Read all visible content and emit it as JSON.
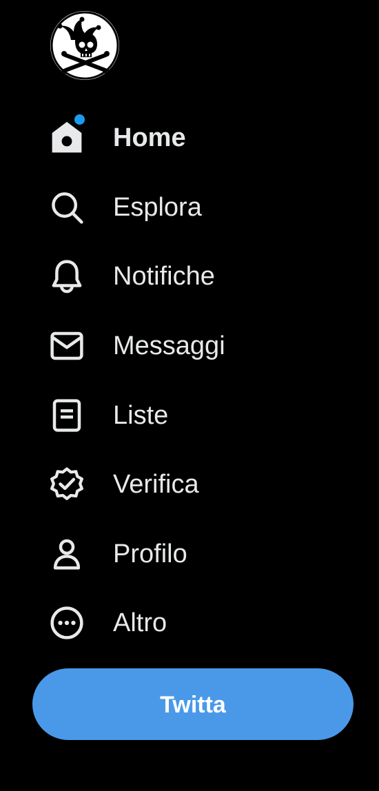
{
  "logo": {
    "icon": "jolly-roger-jester-skull-icon"
  },
  "nav": {
    "items": [
      {
        "label": "Home",
        "icon": "home-icon",
        "active": true
      },
      {
        "label": "Esplora",
        "icon": "search-icon",
        "active": false
      },
      {
        "label": "Notifiche",
        "icon": "bell-icon",
        "active": false
      },
      {
        "label": "Messaggi",
        "icon": "envelope-icon",
        "active": false
      },
      {
        "label": "Liste",
        "icon": "list-icon",
        "active": false
      },
      {
        "label": "Verifica",
        "icon": "verified-badge-icon",
        "active": false
      },
      {
        "label": "Profilo",
        "icon": "person-icon",
        "active": false
      },
      {
        "label": "Altro",
        "icon": "more-circle-icon",
        "active": false
      }
    ]
  },
  "tweet_button": {
    "label": "Twitta"
  },
  "colors": {
    "background": "#000000",
    "text": "#e7e9ea",
    "accent": "#4a99e9",
    "notification_dot": "#1d9bf0"
  }
}
